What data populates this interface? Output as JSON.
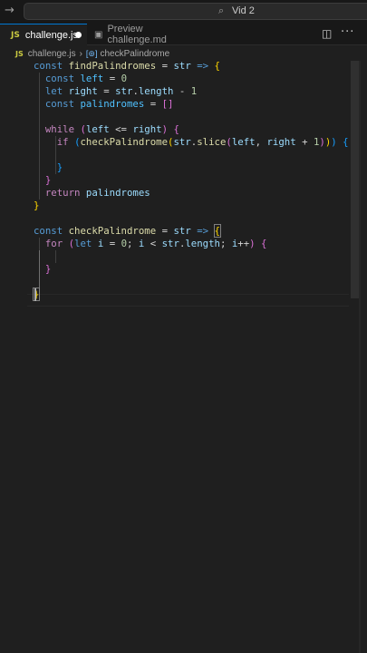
{
  "titlebar": {
    "search_text": "Vid 2"
  },
  "tabs": [
    {
      "label": "challenge.js",
      "icon": "js-icon",
      "modified": true
    },
    {
      "label": "Preview challenge.md",
      "icon": "markdown-preview-icon"
    }
  ],
  "breadcrumb": {
    "file": "challenge.js",
    "symbol": "checkPalindrome"
  },
  "code": [
    "const findPalindromes = str => {",
    "  const left = 0",
    "  let right = str.length - 1",
    "  const palindromes = []",
    "",
    "  while (left <= right) {",
    "    if (checkPalindrome(str.slice(left, right + 1))) {",
    "",
    "    }",
    "  }",
    "  return palindromes",
    "}",
    "",
    "const checkPalindrome = str => {",
    "  for (let i = 0; i < str.length; i++) {",
    "",
    "  }",
    "",
    "}"
  ],
  "colors": {
    "keyword": "#569cd6",
    "control": "#c586c0",
    "function": "#dcdcaa",
    "variable": "#9cdcfe",
    "constant": "#4fc1ff",
    "number": "#b5cea8",
    "accent": "#0078d4"
  }
}
